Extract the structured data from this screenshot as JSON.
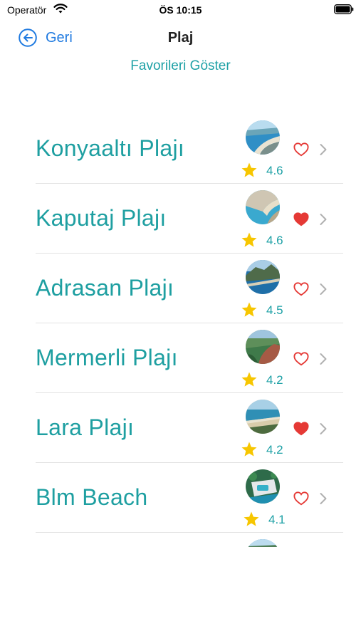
{
  "status_bar": {
    "carrier": "Operatör",
    "time": "ÖS 10:15"
  },
  "nav": {
    "back_label": "Geri",
    "title": "Plaj"
  },
  "favorites_link": "Favorileri Göster",
  "beaches": [
    {
      "name": "Konyaaltı Plajı",
      "rating": "4.6",
      "favorite": false,
      "photo": "coastline-aerial"
    },
    {
      "name": "Kaputaj Plajı",
      "rating": "4.6",
      "favorite": true,
      "photo": "cove-cliffs"
    },
    {
      "name": "Adrasan Plajı",
      "rating": "4.5",
      "favorite": false,
      "photo": "bay-mountain"
    },
    {
      "name": "Mermerli Plajı",
      "rating": "4.2",
      "favorite": false,
      "photo": "cliff-greenery"
    },
    {
      "name": "Lara Plajı",
      "rating": "4.2",
      "favorite": true,
      "photo": "sandy-shore"
    },
    {
      "name": "Blm Beach",
      "rating": "4.1",
      "favorite": false,
      "photo": "resort-pool"
    },
    {
      "name": "",
      "rating": "",
      "favorite": false,
      "photo": "beach-partial"
    }
  ],
  "colors": {
    "accent": "#1ea1a6",
    "link": "#1f7ae0",
    "heart": "#e53935",
    "star": "#f7c600"
  }
}
